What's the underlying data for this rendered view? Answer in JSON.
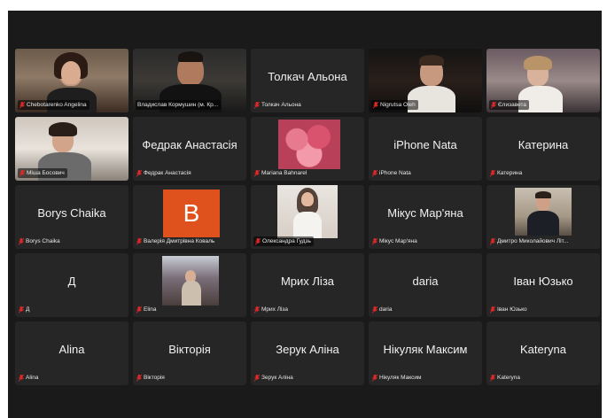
{
  "colors": {
    "background": "#1a1a1a",
    "tile": "#262626",
    "active_border": "#23d959",
    "muted_mic": "#e02828"
  },
  "participants": [
    {
      "display": "",
      "label": "Chebotarenko Angelina"
    },
    {
      "display": "",
      "label": "Владислав Кормушин (м. Кр..."
    },
    {
      "display": "Толкач Альона",
      "label": "Толкач Альона"
    },
    {
      "display": "",
      "label": "Nigrutsa Oleh"
    },
    {
      "display": "",
      "label": "Єлизавета"
    },
    {
      "display": "",
      "label": "Міша Босович"
    },
    {
      "display": "Федрак Анастасія",
      "label": "Федрак Анастасія"
    },
    {
      "display": "",
      "label": "Mariana Bahnarel"
    },
    {
      "display": "iPhone Nata",
      "label": "iPhone Nata"
    },
    {
      "display": "Катерина",
      "label": "Катерина"
    },
    {
      "display": "Borys Chaika",
      "label": "Borys Chaika"
    },
    {
      "display": "B",
      "label": "Валерія Дмитрівна Коваль"
    },
    {
      "display": "",
      "label": "Олександра Гудзь"
    },
    {
      "display": "Мікус Мар'яна",
      "label": "Мікус Мар'яна"
    },
    {
      "display": "",
      "label": "Дмитро Миколайович Літ..."
    },
    {
      "display": "Д",
      "label": "Д"
    },
    {
      "display": "",
      "label": "Elina"
    },
    {
      "display": "Мрих Ліза",
      "label": "Мрих Ліза"
    },
    {
      "display": "daria",
      "label": "daria"
    },
    {
      "display": "Іван Юзько",
      "label": "Іван Юзько"
    },
    {
      "display": "Alina",
      "label": "Alina"
    },
    {
      "display": "Вікторія",
      "label": "Вікторія"
    },
    {
      "display": "Зерук Аліна",
      "label": "Зерук Аліна"
    },
    {
      "display": "Нікуляк Максим",
      "label": "Нікуляк Максим"
    },
    {
      "display": "Kateryna",
      "label": "Kateryna"
    }
  ]
}
